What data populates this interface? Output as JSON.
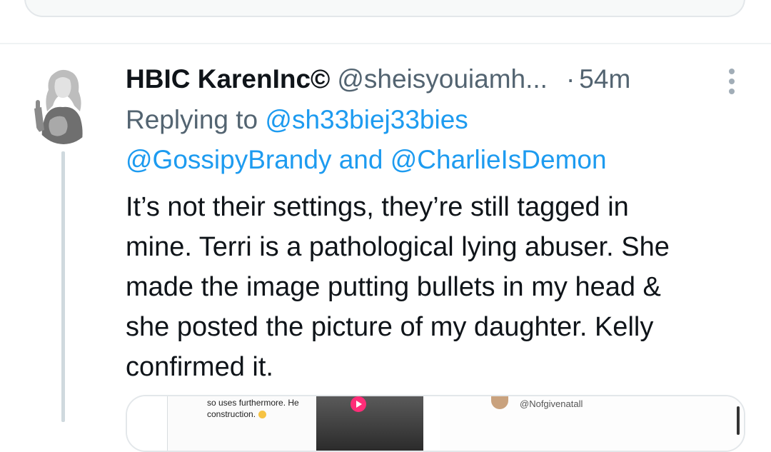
{
  "tweet": {
    "display_name": "HBIC KarenInc©",
    "handle": "@sheisyouiamh...",
    "separator": "·",
    "time": "54m",
    "replying_to_label": "Replying to",
    "mentions": [
      "@sh33biej33bies",
      "@GossipyBrandy",
      "@CharlieIsDemon"
    ],
    "mention_conjunction": "and",
    "text_lines": [
      "It’s not their settings, they’re still tagged in",
      "mine. Terri is a pathological lying abuser. She",
      "made the image putting bullets in my head &",
      "she posted the picture of my daughter. Kelly",
      "confirmed it."
    ]
  },
  "media": {
    "left_snippet_line1": "so uses furthermore. He",
    "left_snippet_line2": "construction.",
    "right_handle": "@Nofgivenatall"
  },
  "icons": {
    "more": "more-vertical-icon",
    "avatar": "avatar",
    "play": "play-icon"
  },
  "colors": {
    "link": "#1d9bf0",
    "secondary_text": "#536471",
    "primary_text": "#0f1419",
    "thread_line": "#cfd9de"
  }
}
